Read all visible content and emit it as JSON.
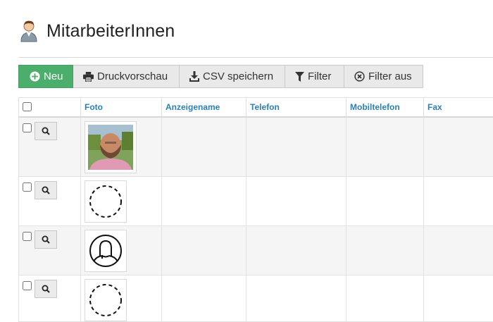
{
  "page": {
    "title": "MitarbeiterInnen",
    "title_icon": "user-person-icon"
  },
  "toolbar": {
    "buttons": [
      {
        "label": "Neu",
        "icon": "plus-circle-icon"
      },
      {
        "label": "Druckvorschau",
        "icon": "printer-icon"
      },
      {
        "label": "CSV speichern",
        "icon": "download-icon"
      },
      {
        "label": "Filter",
        "icon": "funnel-icon"
      },
      {
        "label": "Filter aus",
        "icon": "x-circle-icon"
      }
    ],
    "primary_color": "#4cae6c"
  },
  "table": {
    "columns": [
      "Foto",
      "Anzeigename",
      "Telefon",
      "Mobiltelefon",
      "Fax"
    ],
    "header_color": "#2d7fb6",
    "rows": [
      {
        "photo": "profile-photo",
        "anzeigename": "",
        "telefon": "",
        "mobiltelefon": "",
        "fax": ""
      },
      {
        "photo": "empty-avatar-placeholder",
        "anzeigename": "",
        "telefon": "",
        "mobiltelefon": "",
        "fax": ""
      },
      {
        "photo": "user-silhouette-avatar",
        "anzeigename": "",
        "telefon": "",
        "mobiltelefon": "",
        "fax": ""
      },
      {
        "photo": "empty-avatar-placeholder",
        "anzeigename": "",
        "telefon": "",
        "mobiltelefon": "",
        "fax": ""
      }
    ]
  }
}
